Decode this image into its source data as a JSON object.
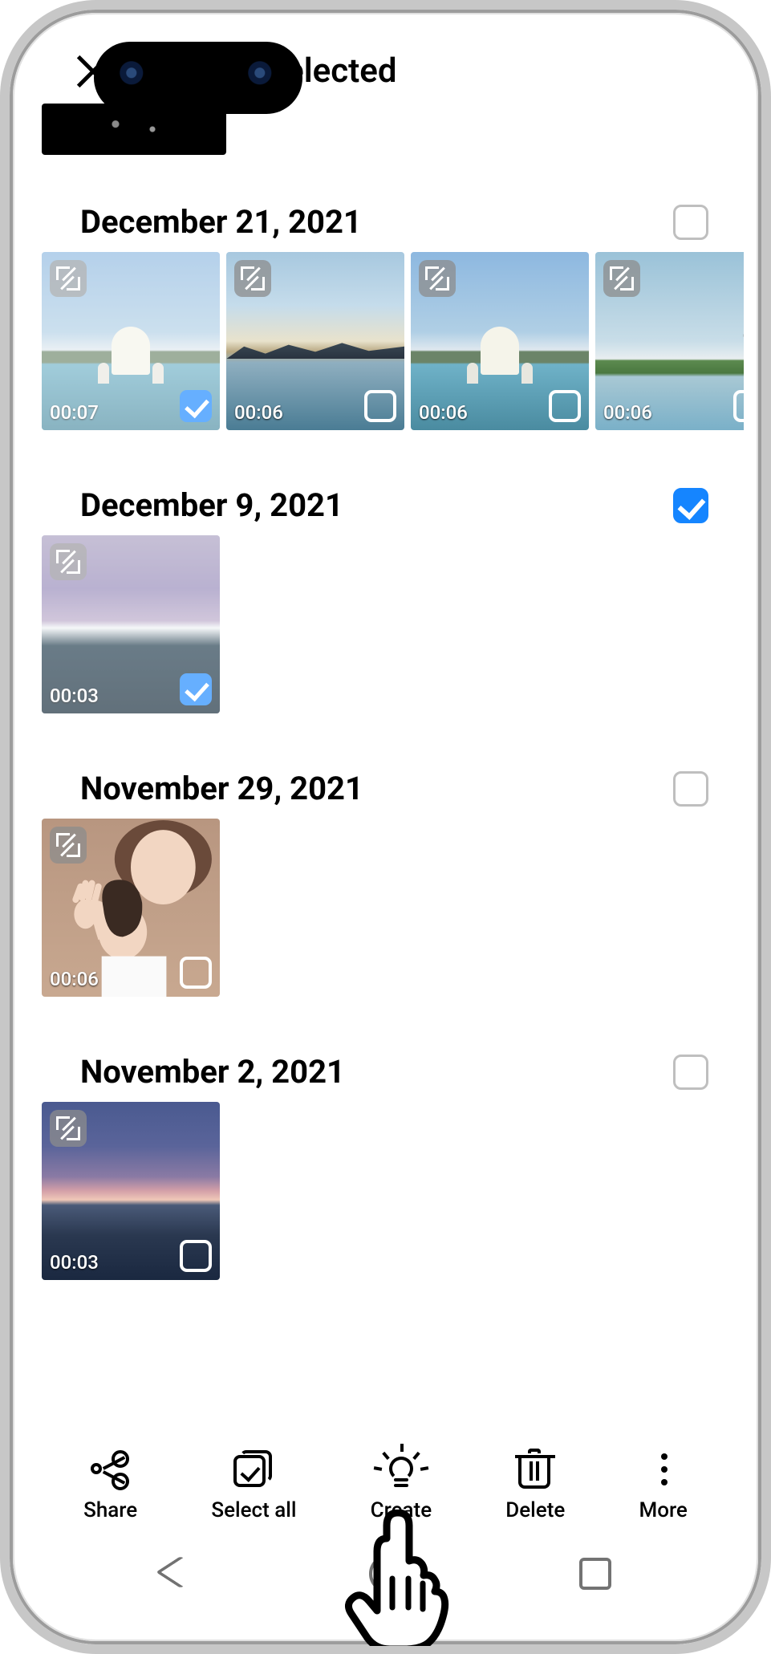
{
  "header": {
    "title": "2 items selected"
  },
  "sections": [
    {
      "date": "December 21, 2021",
      "all_selected": false,
      "items": [
        {
          "duration": "00:07",
          "checked": true,
          "scene": "taj-faded"
        },
        {
          "duration": "00:06",
          "checked": false,
          "scene": "mountain-lake"
        },
        {
          "duration": "00:06",
          "checked": false,
          "scene": "taj"
        },
        {
          "duration": "00:06",
          "checked": false,
          "scene": "pagoda-lake"
        }
      ]
    },
    {
      "date": "December 9, 2021",
      "all_selected": true,
      "items": [
        {
          "duration": "00:03",
          "checked": true,
          "scene": "purple-night-faded"
        }
      ]
    },
    {
      "date": "November 29, 2021",
      "all_selected": false,
      "items": [
        {
          "duration": "00:06",
          "checked": false,
          "scene": "person-wave"
        }
      ]
    },
    {
      "date": "November 2, 2021",
      "all_selected": false,
      "items": [
        {
          "duration": "00:03",
          "checked": false,
          "scene": "dusk-lake"
        }
      ]
    }
  ],
  "toolbar": {
    "share": "Share",
    "selectall": "Select all",
    "create": "Create",
    "delete": "Delete",
    "more": "More"
  },
  "pointer_target": "create"
}
